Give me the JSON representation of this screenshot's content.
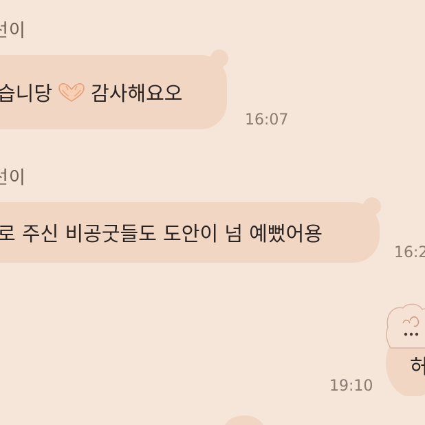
{
  "messages": [
    {
      "sender": "선이",
      "text_before": "습니당",
      "emoji": "heart-hands",
      "text_after": "감사해요오",
      "time": "16:07"
    },
    {
      "sender": "선이",
      "text": "로 주신 비공굿들도 도안이 넘 예뻤어용",
      "time": "16:2"
    },
    {
      "sticker": "puppy-sticker",
      "partial_text": "허",
      "time": "19:10"
    }
  ],
  "colors": {
    "background": "#f6e6da",
    "bubble": "#f1d6c4",
    "text": "#2a2220",
    "time": "#8b7a72"
  }
}
